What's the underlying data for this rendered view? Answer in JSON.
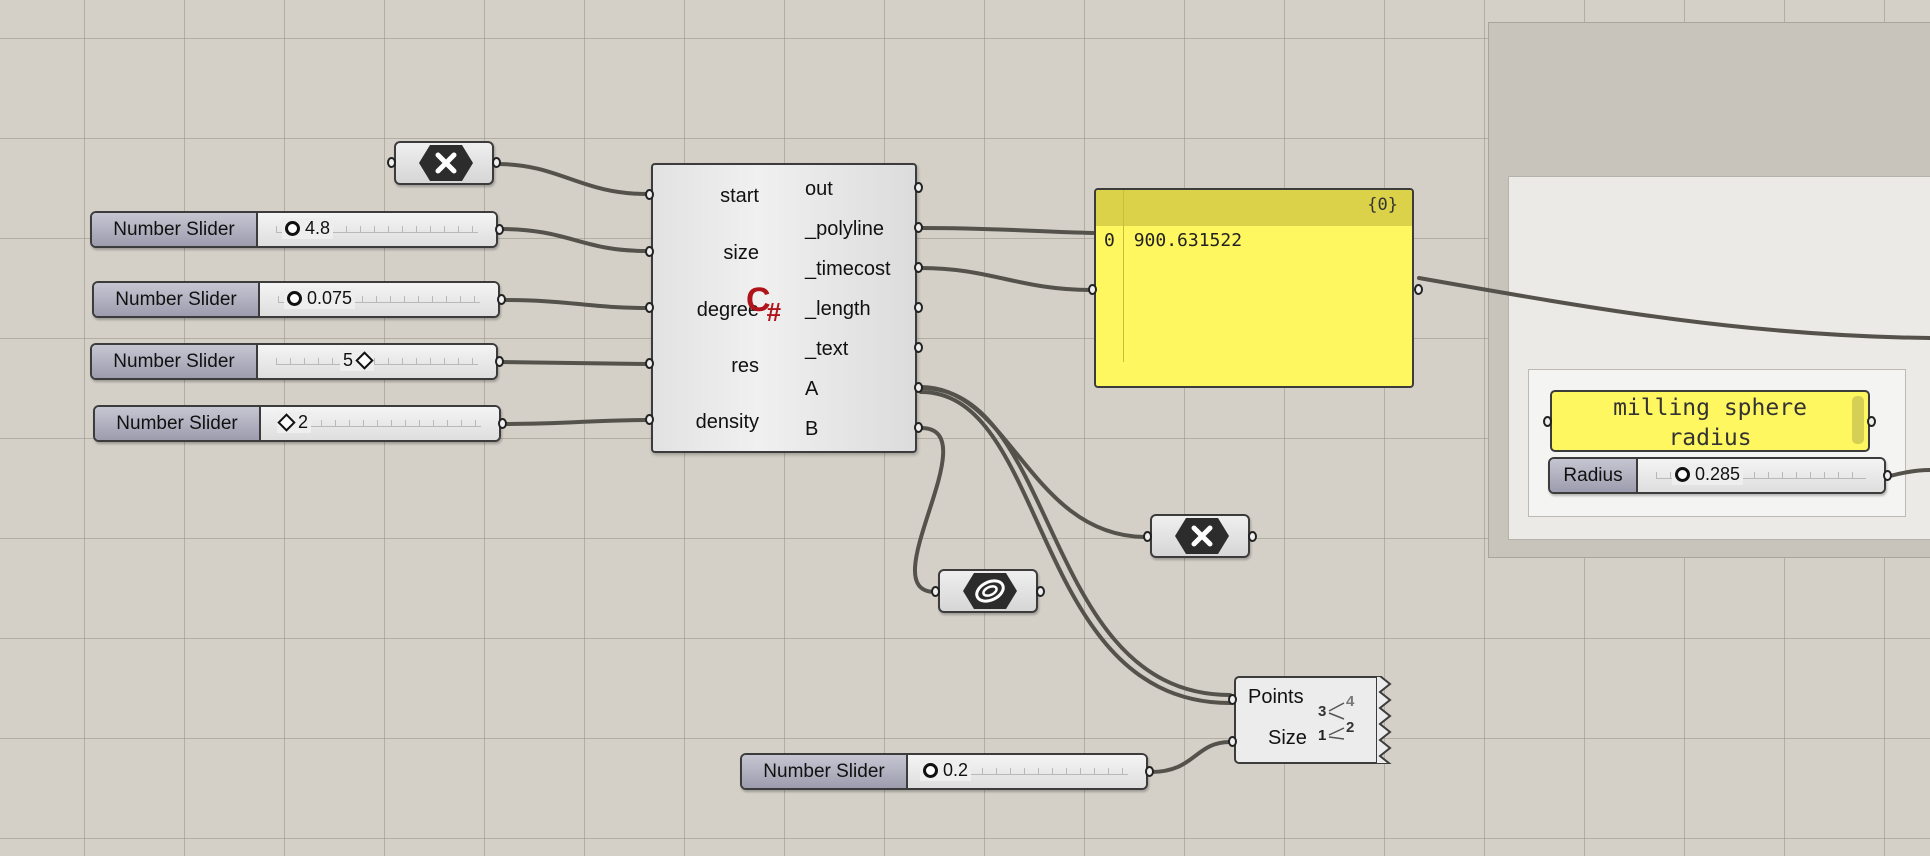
{
  "canvas": {
    "background": "#d4d0c8",
    "grid_color": "#969187",
    "wire_color": "#55524c"
  },
  "sliders": [
    {
      "id": "size",
      "label": "Number Slider",
      "value": "4.8",
      "knob": "circle"
    },
    {
      "id": "degree",
      "label": "Number Slider",
      "value": "0.075",
      "knob": "circle"
    },
    {
      "id": "res",
      "label": "Number Slider",
      "value": "5",
      "knob": "diamond"
    },
    {
      "id": "density",
      "label": "Number Slider",
      "value": "2",
      "knob": "diamond"
    },
    {
      "id": "size2",
      "label": "Number Slider",
      "value": "0.2",
      "knob": "circle"
    },
    {
      "id": "radius",
      "label": "Radius",
      "value": "0.285",
      "knob": "circle"
    }
  ],
  "script_component": {
    "icon": "csharp-icon",
    "icon_text": "C",
    "icon_sub": "#",
    "icon_color": "#b0141a",
    "inputs": [
      "start",
      "size",
      "degree",
      "res",
      "density"
    ],
    "outputs": [
      "out",
      "_polyline",
      "_timecost",
      "_length",
      "_text",
      "A",
      "B"
    ]
  },
  "panel": {
    "count": "{0}",
    "index": "0",
    "value": "900.631522",
    "color": "#fff760"
  },
  "note": {
    "line1": "milling sphere",
    "line2": "radius"
  },
  "tag_component": {
    "inputs": [
      "Points",
      "Size"
    ],
    "icon": "point-list-icon"
  },
  "hex_buttons": [
    {
      "icon": "close-icon"
    },
    {
      "icon": "close-icon"
    },
    {
      "icon": "curve-icon"
    }
  ]
}
